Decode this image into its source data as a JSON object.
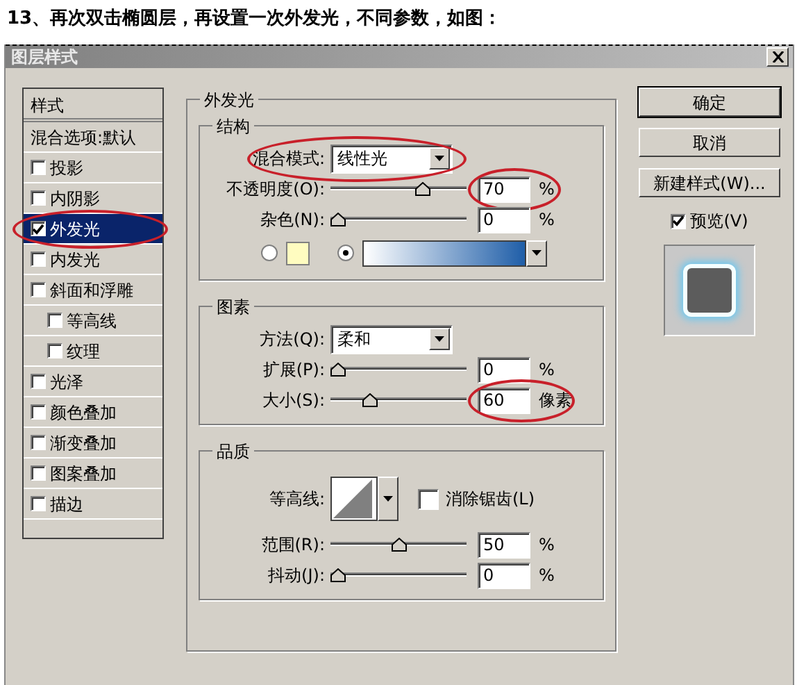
{
  "caption": "13、再次双击椭圆层，再设置一次外发光，不同参数，如图：",
  "window": {
    "title": "图层样式"
  },
  "sidebar": {
    "header": "样式",
    "items": [
      {
        "label": "混合选项:默认",
        "kind": "heading",
        "selected": false
      },
      {
        "label": "投影",
        "kind": "option",
        "checked": false,
        "selected": false
      },
      {
        "label": "内阴影",
        "kind": "option",
        "checked": false,
        "selected": false
      },
      {
        "label": "外发光",
        "kind": "option",
        "checked": true,
        "selected": true,
        "circled": true
      },
      {
        "label": "内发光",
        "kind": "option",
        "checked": false,
        "selected": false
      },
      {
        "label": "斜面和浮雕",
        "kind": "option",
        "checked": false,
        "selected": false,
        "children": [
          {
            "label": "等高线",
            "kind": "option",
            "checked": false,
            "selected": false
          },
          {
            "label": "纹理",
            "kind": "option",
            "checked": false,
            "selected": false
          }
        ]
      },
      {
        "label": "光泽",
        "kind": "option",
        "checked": false,
        "selected": false
      },
      {
        "label": "颜色叠加",
        "kind": "option",
        "checked": false,
        "selected": false
      },
      {
        "label": "渐变叠加",
        "kind": "option",
        "checked": false,
        "selected": false
      },
      {
        "label": "图案叠加",
        "kind": "option",
        "checked": false,
        "selected": false
      },
      {
        "label": "描边",
        "kind": "option",
        "checked": false,
        "selected": false
      }
    ]
  },
  "panel": {
    "title": "外发光",
    "groups": [
      {
        "title": "结构",
        "rows": [
          {
            "kind": "select",
            "label": "混合模式:",
            "value": "线性光",
            "circled": true
          },
          {
            "kind": "slider",
            "label": "不透明度(O):",
            "level": 0.7,
            "value": "70",
            "unit": "%",
            "circled": true
          },
          {
            "kind": "slider",
            "label": "杂色(N):",
            "level": 0,
            "value": "0",
            "unit": "%"
          },
          {
            "kind": "source",
            "options": [
              {
                "kind": "color",
                "color": "#fffcc0",
                "selected": false
              },
              {
                "kind": "gradient",
                "selected": true
              }
            ]
          }
        ]
      },
      {
        "title": "图素",
        "rows": [
          {
            "kind": "select",
            "label": "方法(Q):",
            "value": "柔和"
          },
          {
            "kind": "slider",
            "label": "扩展(P):",
            "level": 0,
            "value": "0",
            "unit": "%"
          },
          {
            "kind": "slider",
            "label": "大小(S):",
            "level": 0.27,
            "value": "60",
            "unit": "像素",
            "circled": true
          }
        ]
      },
      {
        "title": "品质",
        "rows": [
          {
            "kind": "contour",
            "label": "等高线:",
            "checkbox": {
              "label": "消除锯齿(L)",
              "checked": false
            }
          },
          {
            "kind": "slider",
            "label": "范围(R):",
            "level": 0.5,
            "value": "50",
            "unit": "%"
          },
          {
            "kind": "slider",
            "label": "抖动(J):",
            "level": 0,
            "value": "0",
            "unit": "%"
          }
        ]
      }
    ]
  },
  "buttons": [
    {
      "label": "确定",
      "default": true
    },
    {
      "label": "取消",
      "default": false
    },
    {
      "label": "新建样式(W)...",
      "default": false
    }
  ],
  "preview": {
    "label": "预览(V)",
    "checked": true
  }
}
